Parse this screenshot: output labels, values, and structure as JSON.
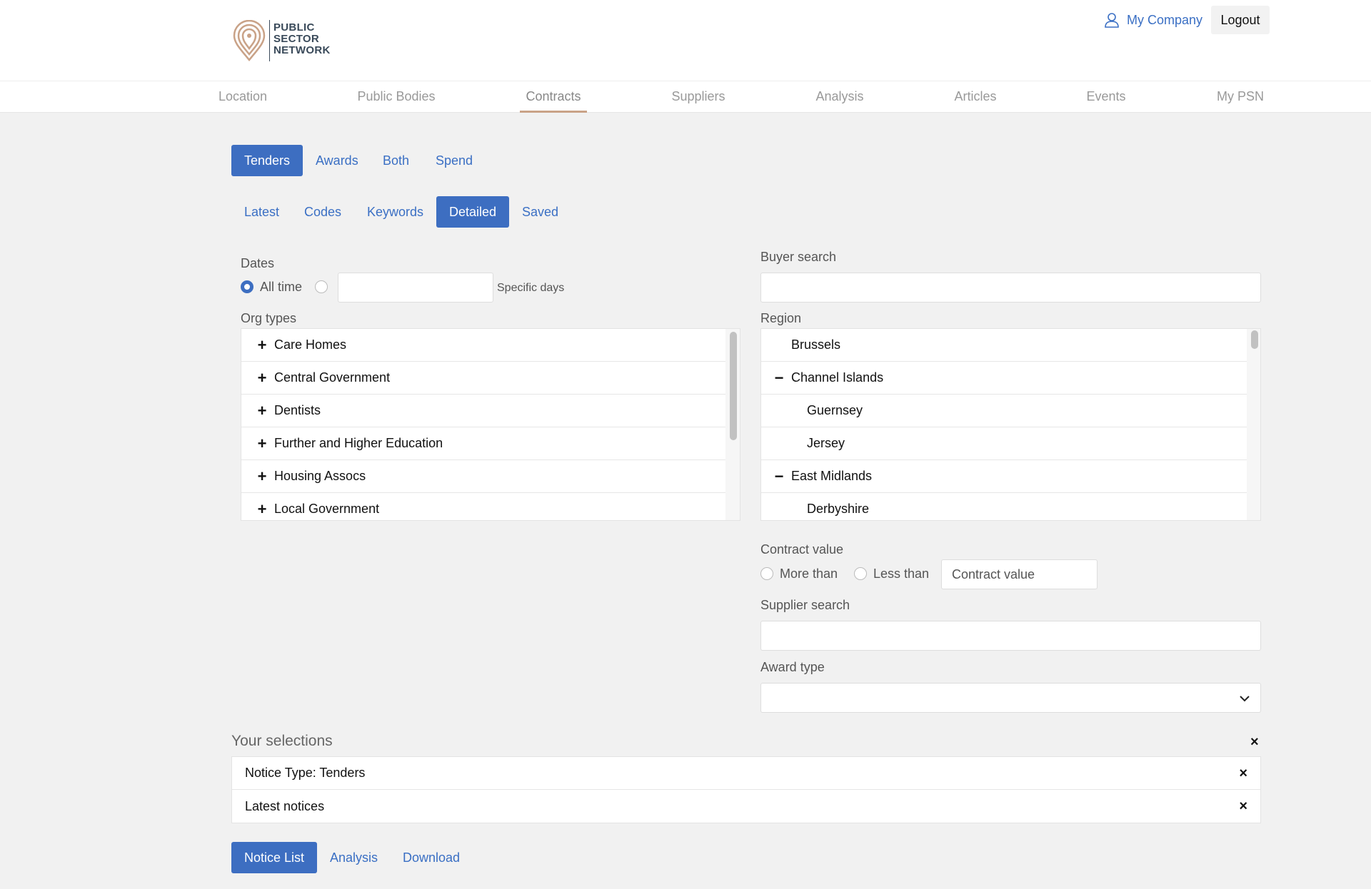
{
  "brand": {
    "logo_lines": [
      "PUBLIC",
      "SECTOR",
      "NETWORK"
    ],
    "accent_color": "#c9a287",
    "primary_color": "#3d6ec1"
  },
  "header": {
    "user_label": "My Company",
    "logout_label": "Logout"
  },
  "nav": {
    "items": [
      "Location",
      "Public Bodies",
      "Contracts",
      "Suppliers",
      "Analysis",
      "Articles",
      "Events",
      "My PSN"
    ],
    "active": "Contracts"
  },
  "notice_tabs": {
    "items": [
      "Tenders",
      "Awards",
      "Both",
      "Spend"
    ],
    "active": "Tenders"
  },
  "search_tabs": {
    "items": [
      "Latest",
      "Codes",
      "Keywords",
      "Detailed",
      "Saved"
    ],
    "active": "Detailed"
  },
  "dates": {
    "label": "Dates",
    "option_all": "All time",
    "specific_label": "Specific days",
    "selected": "All time"
  },
  "org_types": {
    "label": "Org types",
    "items": [
      "Care Homes",
      "Central Government",
      "Dentists",
      "Further and Higher Education",
      "Housing Assocs",
      "Local Government"
    ]
  },
  "buyer_search": {
    "label": "Buyer search",
    "value": ""
  },
  "region": {
    "label": "Region",
    "items": [
      {
        "label": "Brussels",
        "level": 0,
        "toggle": ""
      },
      {
        "label": "Channel Islands",
        "level": 0,
        "toggle": "minus"
      },
      {
        "label": "Guernsey",
        "level": 1,
        "toggle": ""
      },
      {
        "label": "Jersey",
        "level": 1,
        "toggle": ""
      },
      {
        "label": "East Midlands",
        "level": 0,
        "toggle": "minus"
      },
      {
        "label": "Derbyshire",
        "level": 1,
        "toggle": ""
      }
    ]
  },
  "contract_value": {
    "label": "Contract value",
    "more_than": "More than",
    "less_than": "Less than",
    "placeholder": "Contract value"
  },
  "supplier_search": {
    "label": "Supplier search",
    "value": ""
  },
  "award_type": {
    "label": "Award type",
    "value": ""
  },
  "selections": {
    "title": "Your selections",
    "items": [
      "Notice Type: Tenders",
      "Latest notices"
    ]
  },
  "result_tabs": {
    "items": [
      "Notice List",
      "Analysis",
      "Download"
    ],
    "active": "Notice List"
  }
}
